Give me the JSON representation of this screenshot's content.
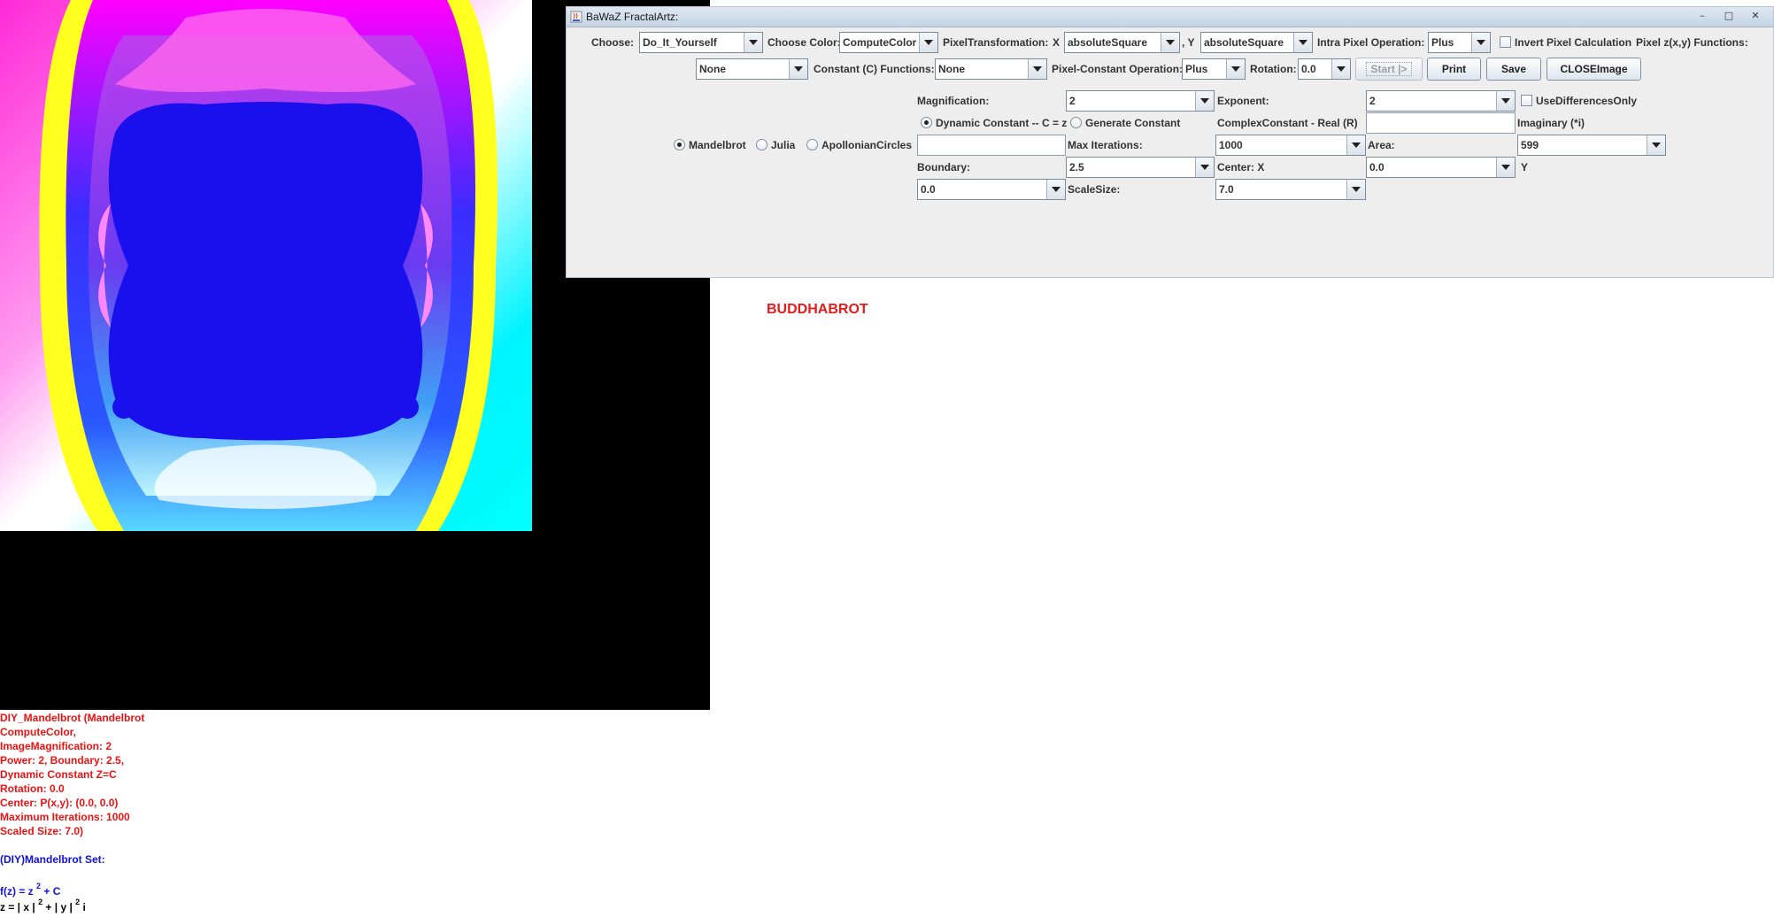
{
  "window": {
    "title": "BaWaZ FractalArtz:",
    "controls": {
      "minimize": "–",
      "maximize": "□",
      "close": "✕"
    }
  },
  "row1": {
    "choose_label": "Choose:",
    "choose_value": "Do_It_Yourself",
    "color_label": "Choose Color:",
    "color_value": "ComputeColor",
    "pixeltrans_label": "PixelTransformation:",
    "x_label": "X",
    "x_value": "absoluteSquare",
    "y_label": ", Y",
    "y_value": "absoluteSquare",
    "intra_label": "Intra Pixel Operation:",
    "intra_value": "Plus",
    "invert_label": "Invert Pixel Calculation",
    "pixelfn_label": "Pixel z(x,y) Functions:"
  },
  "row2": {
    "pixelfn_value": "None",
    "constfn_label": "Constant (C) Functions:",
    "constfn_value": "None",
    "pcop_label": "Pixel-Constant Operation:",
    "pcop_value": "Plus",
    "rotation_label": "Rotation:",
    "rotation_value": "0.0",
    "start_label": "Start |>",
    "print_label": "Print",
    "save_label": "Save",
    "close_image_label": "CLOSEImage"
  },
  "params": {
    "magnification_label": "Magnification:",
    "magnification_value": "2",
    "exponent_label": "Exponent:",
    "exponent_value": "2",
    "usediff_label": "UseDifferencesOnly",
    "dynamic_label": "Dynamic Constant -- C = z",
    "generate_label": "Generate Constant",
    "complex_real_label": "ComplexConstant - Real (R)",
    "imaginary_label": "Imaginary (*i)",
    "mandelbrot_label": "Mandelbrot",
    "julia_label": "Julia",
    "apollonian_label": "ApollonianCircles",
    "maxiter_label": "Max Iterations:",
    "maxiter_value": "1000",
    "area_label": "Area:",
    "area_value": "599",
    "boundary_label": "Boundary:",
    "boundary_value": "2.5",
    "centerx_label": "Center: X",
    "centerx_value": "0.0",
    "y_label": "Y",
    "y_value": "0.0",
    "scalesize_label": "ScaleSize:",
    "scalesize_value": "7.0"
  },
  "buddhabrot": "BUDDHABROT",
  "info": {
    "lines": [
      "DIY_Mandelbrot (Mandelbrot",
      "ComputeColor,",
      "ImageMagnification: 2",
      "Power: 2, Boundary: 2.5,",
      "Dynamic Constant Z=C",
      "Rotation: 0.0",
      "Center: P(x,y): (0.0, 0.0)",
      "Maximum Iterations: 1000",
      "Scaled Size: 7.0)"
    ],
    "set_title": "(DIY)Mandelbrot Set:",
    "formula_f_a": "f(z) = z ",
    "formula_f_exp": "2",
    "formula_f_b": " + C",
    "formula_z_a": "z = | x | ",
    "formula_z_exp1": "2",
    "formula_z_b": " + | y | ",
    "formula_z_exp2": "2",
    "formula_z_c": " i"
  },
  "colors": {
    "set_fill": "#1a10ee",
    "accent_red": "#e31c1c",
    "text_blue": "#1111dd"
  }
}
